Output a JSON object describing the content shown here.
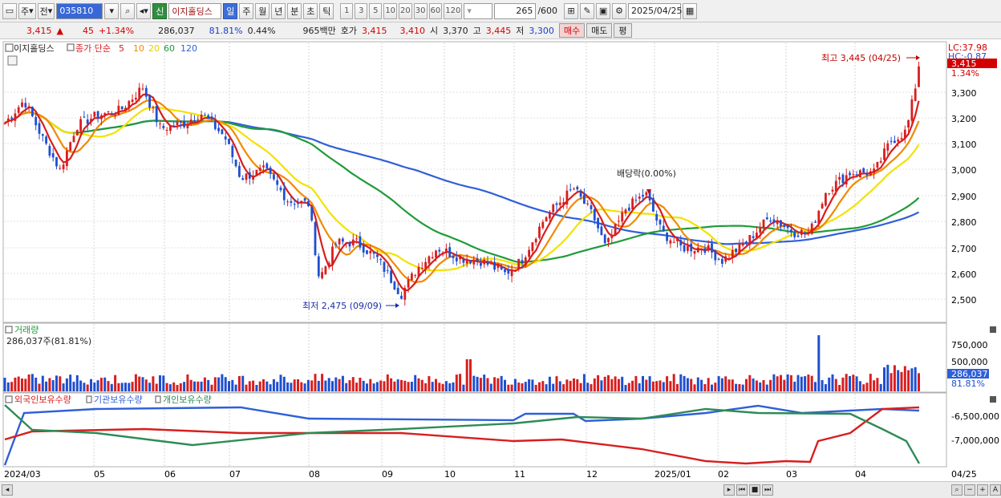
{
  "toolbar": {
    "market": "주",
    "prev": "전",
    "code": "035810",
    "name": "이지홀딩스",
    "new_badge": "신",
    "periods": [
      "일",
      "주",
      "월",
      "년",
      "분",
      "초",
      "틱"
    ],
    "minutes": [
      "1",
      "3",
      "5",
      "10",
      "20",
      "30",
      "60",
      "120"
    ],
    "count": "265",
    "count_total": "/600",
    "date": "2025/04/25"
  },
  "quote": {
    "price": "3,415",
    "change": "45",
    "change_pct": "+1.34%",
    "volume": "286,037",
    "vol_ratio": "81.81%",
    "turnover_ratio": "0.44%",
    "amount": "965백만",
    "ask_label": "호가",
    "ask": "3,415",
    "bid": "3,410",
    "open_label": "시",
    "open": "3,370",
    "high_label": "고",
    "high": "3,445",
    "low_label": "저",
    "low": "3,300",
    "buy_btn": "매수",
    "sell_btn": "매도",
    "avg_btn": "평"
  },
  "price_panel": {
    "legend_name": "이지홀딩스",
    "legend_ma_label": "종가 단순",
    "ma_periods": [
      "5",
      "10",
      "20",
      "60",
      "120"
    ],
    "ma_colors": [
      "#d81e1e",
      "#f08a00",
      "#f2e200",
      "#1f9b3a",
      "#2f5fd8"
    ],
    "right_lc": "LC:37.98",
    "right_hc": "HC:-0.87",
    "price_tag": "3,415",
    "price_tag_pct": "1.34%",
    "high_annotation": "최고 3,445 (04/25)",
    "low_annotation": "최저 2,475 (09/09)",
    "dividend_annotation": "배당락(0.00%)",
    "y_ticks": [
      "3,300",
      "3,200",
      "3,100",
      "3,000",
      "2,900",
      "2,800",
      "2,700",
      "2,600",
      "2,500"
    ]
  },
  "volume_panel": {
    "title": "거래량",
    "value": "286,037주(81.81%)",
    "y_ticks": [
      "750,000",
      "500,000"
    ],
    "tag": "286,037",
    "tag_pct": "81.81%"
  },
  "holding_panel": {
    "legend": [
      "외국인보유수량",
      "기관보유수량",
      "개인보유수량"
    ],
    "legend_colors": [
      "#d81e1e",
      "#2f5fd8",
      "#2e8b57"
    ],
    "y_ticks": [
      "-6,500,000",
      "-7,000,000"
    ]
  },
  "x_axis": [
    "2024/03",
    "05",
    "06",
    "07",
    "08",
    "09",
    "10",
    "11",
    "12",
    "2025/01",
    "02",
    "03",
    "04"
  ],
  "x_axis_right": "04/25",
  "colors": {
    "up": "#d81e1e",
    "down": "#1f4fd0",
    "grid": "#c8c8c8"
  }
}
